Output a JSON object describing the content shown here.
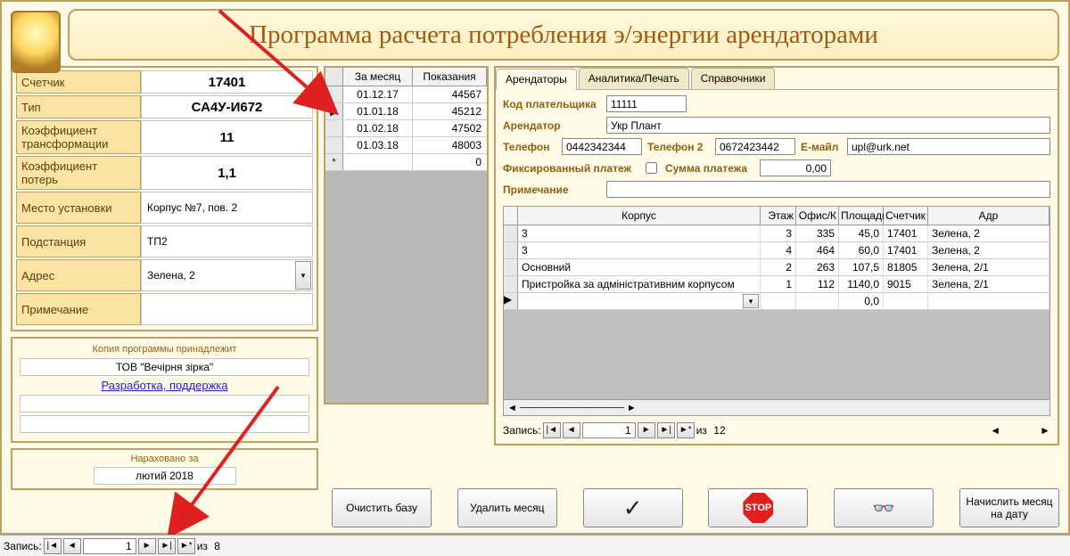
{
  "banner": {
    "title": "Программа расчета потребления э/энергии арендаторами"
  },
  "meter": {
    "labels": {
      "id": "Счетчик",
      "type": "Тип",
      "ktrans": "Коэффициент трансформации",
      "kloss": "Коэффициент потерь",
      "place": "Место установки",
      "substation": "Подстанция",
      "address": "Адрес",
      "note": "Примечание"
    },
    "values": {
      "id": "17401",
      "type": "СА4У-И672",
      "ktrans": "11",
      "kloss": "1,1",
      "place": "Корпус №7, пов. 2",
      "substation": "ТП2",
      "address": "Зелена, 2",
      "note": ""
    }
  },
  "readings": {
    "headers": {
      "month": "За месяц",
      "value": "Показания"
    },
    "rows": [
      {
        "sel": "",
        "date": "01.12.17",
        "val": "44567"
      },
      {
        "sel": "▶",
        "date": "01.01.18",
        "val": "45212"
      },
      {
        "sel": "",
        "date": "01.02.18",
        "val": "47502"
      },
      {
        "sel": "",
        "date": "01.03.18",
        "val": "48003"
      },
      {
        "sel": "*",
        "date": "",
        "val": "0"
      }
    ]
  },
  "tabs": {
    "t1": "Арендаторы",
    "t2": "Аналитика/Печать",
    "t3": "Справочники"
  },
  "renter": {
    "labels": {
      "code": "Код плательщика",
      "name": "Арендатор",
      "phone": "Телефон",
      "phone2": "Телефон 2",
      "email": "Е-майл",
      "fixed": "Фиксированный платеж",
      "sum": "Сумма платежа",
      "note": "Примечание"
    },
    "values": {
      "code": "11111",
      "name": "Укр Плант",
      "phone": "0442342344",
      "phone2": "0672423442",
      "email": "upl@urk.net",
      "sum": "0,00",
      "note": ""
    }
  },
  "grid": {
    "headers": {
      "korp": "Корпус",
      "floor": "Этаж",
      "office": "Офис/К",
      "area": "Площадь",
      "meter": "Счетчик",
      "addr": "Адр"
    },
    "rows": [
      {
        "korp": "3",
        "floor": "3",
        "office": "335",
        "area": "45,0",
        "meter": "17401",
        "addr": "Зелена, 2"
      },
      {
        "korp": "3",
        "floor": "4",
        "office": "464",
        "area": "60,0",
        "meter": "17401",
        "addr": "Зелена, 2"
      },
      {
        "korp": "Основний",
        "floor": "2",
        "office": "263",
        "area": "107,5",
        "meter": "81805",
        "addr": "Зелена, 2/1"
      },
      {
        "korp": "Пристройка за адміністративним корпусом",
        "floor": "1",
        "office": "112",
        "area": "1140,0",
        "meter": "9015",
        "addr": "Зелена, 2/1"
      }
    ],
    "new_area": "0,0"
  },
  "recnav": {
    "label": "Запись:",
    "pos": "1",
    "of_label": "из",
    "total": "12"
  },
  "bottom_buttons": {
    "clear": "Очистить базу",
    "delmonth": "Удалить месяц",
    "calc": "Начислить месяц на дату"
  },
  "info": {
    "header": "Копия программы принадлежит",
    "owner": "ТОВ \"Вечірня зірка\"",
    "support": "Разработка, поддержка"
  },
  "accrual": {
    "header": "Нараховано за",
    "value": "лютий 2018"
  },
  "globalnav": {
    "label": "Запись:",
    "pos": "1",
    "of_label": "из",
    "total": "8"
  }
}
